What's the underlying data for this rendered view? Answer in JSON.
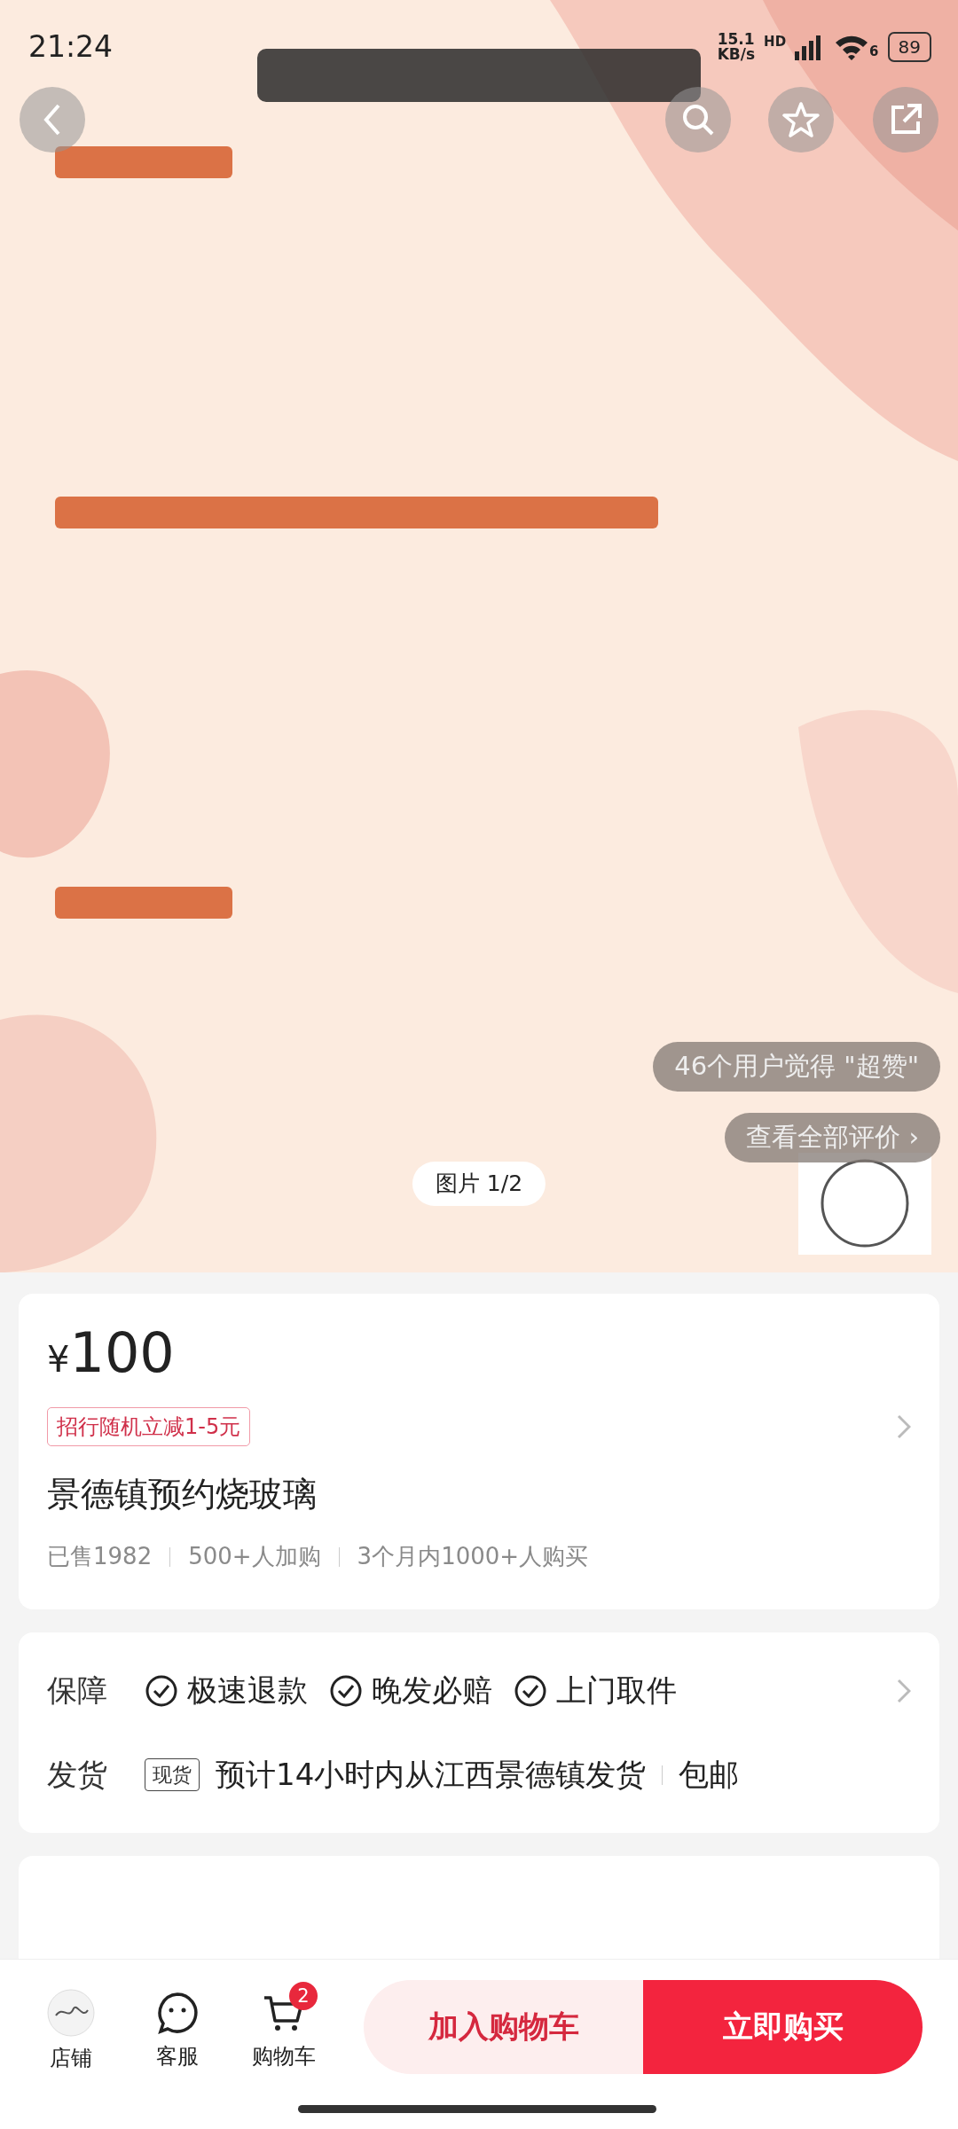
{
  "status_bar": {
    "time": "21:24",
    "net_speed": "15.1",
    "net_unit": "KB/s",
    "network": "HD",
    "wifi_band": "6",
    "battery": "89"
  },
  "gallery": {
    "kind": "picture",
    "rating_bubble": "46个用户觉得 \"超赞\"",
    "reviews_link": "查看全部评价 ›",
    "counter": "图片 1/2"
  },
  "product": {
    "price_symbol": "¥",
    "price": "100",
    "promo": "招行随机立减1-5元",
    "title": "景德镇预约烧玻璃",
    "stats": [
      "已售1982",
      "500+人加购",
      "3个月内1000+人购买"
    ]
  },
  "service": {
    "guarantee_label": "保障",
    "guarantees": [
      "极速退款",
      "晚发必赔",
      "上门取件"
    ],
    "shipping_label": "发货",
    "stock_tag": "现货",
    "shipping_text": "预计14小时内从江西景德镇发货",
    "shipping_extra": "包邮"
  },
  "bottom_bar": {
    "tabs": [
      {
        "kind": "shop",
        "label": "店铺"
      },
      {
        "kind": "service",
        "label": "客服"
      },
      {
        "kind": "cart",
        "label": "购物车",
        "badge": "2"
      }
    ],
    "add_to_cart": "加入购物车",
    "buy_now": "立即购买"
  }
}
